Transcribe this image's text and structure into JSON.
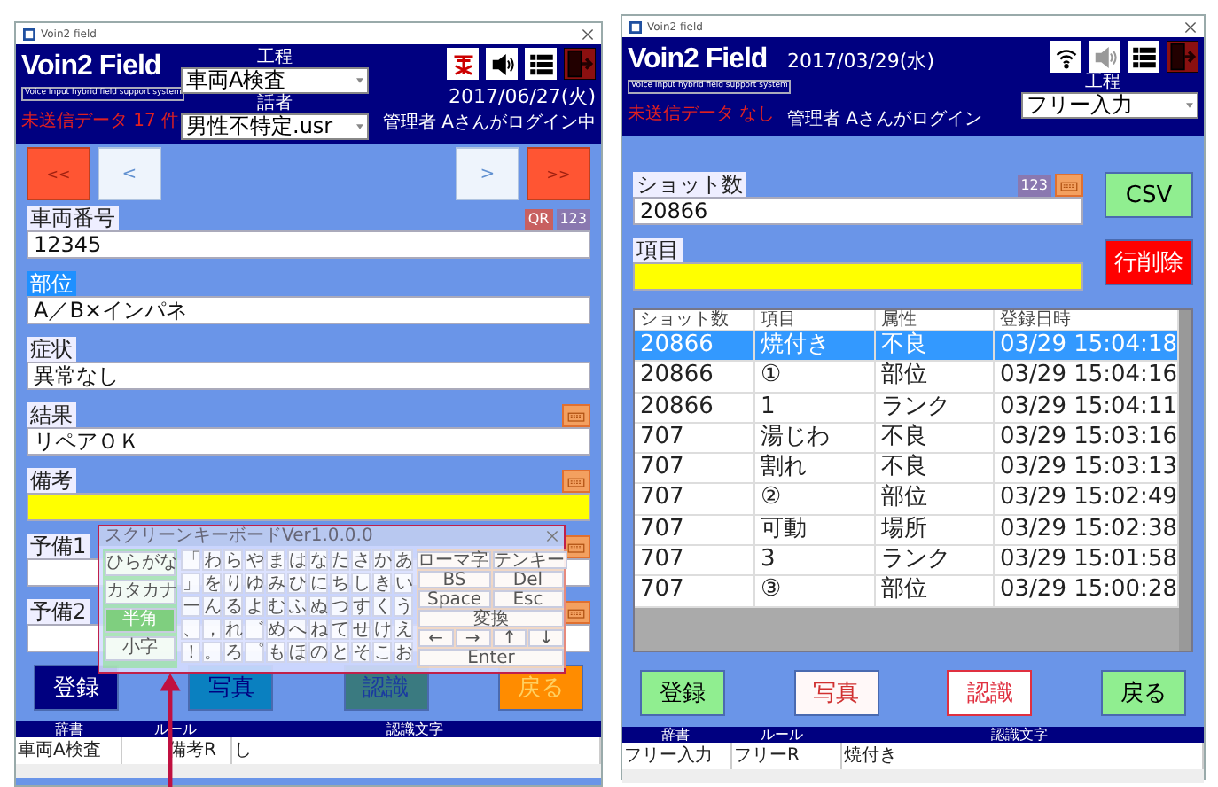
{
  "left_window": {
    "title": "Voin2 field",
    "logo": "Voin2 Field",
    "tagline": "Voice Input hybrid field support system",
    "unsent": "未送信データ 17 件",
    "process": {
      "label": "工程",
      "value": "車両A検査"
    },
    "speaker": {
      "label": "話者",
      "value": "男性不特定.usr"
    },
    "toolbar": [
      {
        "kind": "no-signal"
      },
      {
        "kind": "speaker",
        "disabled": false
      },
      {
        "kind": "list"
      },
      {
        "kind": "exit"
      }
    ],
    "date": "2017/06/27(火)",
    "login": "管理者 Aさんがログイン中",
    "nav_buttons": [
      {
        "label": "<<",
        "kind": "jump"
      },
      {
        "label": "<",
        "kind": "step"
      },
      {
        "label": ">",
        "kind": "step"
      },
      {
        "label": ">>",
        "kind": "jump"
      }
    ],
    "fields": [
      {
        "label": "車両番号",
        "value": "12345",
        "selected": false,
        "focused": false,
        "tools": [
          {
            "kind": "qr",
            "label": "QR"
          },
          {
            "kind": "numpad",
            "label": "123"
          }
        ]
      },
      {
        "label": "部位",
        "value": "A／B×インパネ",
        "selected": true,
        "focused": false
      },
      {
        "label": "症状",
        "value": "異常なし",
        "selected": false,
        "focused": false
      },
      {
        "label": "結果",
        "value": "リペアＯＫ",
        "selected": false,
        "focused": false,
        "tools": [
          {
            "kind": "keyboard"
          }
        ]
      },
      {
        "label": "備考",
        "selected": false,
        "focused": true,
        "tools": [
          {
            "kind": "keyboard"
          }
        ]
      },
      {
        "label": "予備1",
        "selected": false,
        "focused": false,
        "tools": [
          {
            "kind": "keyboard"
          }
        ]
      },
      {
        "label": "予備2",
        "selected": false,
        "focused": false,
        "tools": [
          {
            "kind": "keyboard"
          }
        ]
      }
    ],
    "keyboard": {
      "title": "スクリーンキーボードVer1.0.0.0",
      "modes": [
        {
          "label": "ひらがな",
          "selected": false
        },
        {
          "label": "カタカナ",
          "selected": false
        },
        {
          "label": "半角",
          "selected": true
        },
        {
          "label": "小字",
          "selected": false
        }
      ],
      "kana_rows": [
        [
          "「",
          "わ",
          "ら",
          "や",
          "ま",
          "は",
          "な",
          "た",
          "さ",
          "か",
          "あ"
        ],
        [
          "」",
          "を",
          "り",
          "ゆ",
          "み",
          "ひ",
          "に",
          "ち",
          "し",
          "き",
          "い"
        ],
        [
          "ー",
          "ん",
          "る",
          "よ",
          "む",
          "ふ",
          "ぬ",
          "つ",
          "す",
          "く",
          "う"
        ],
        [
          "、",
          "，",
          "れ",
          "゛",
          "め",
          "へ",
          "ね",
          "て",
          "せ",
          "け",
          "え"
        ],
        [
          "！",
          "。",
          "ろ",
          "゜",
          "も",
          "ほ",
          "の",
          "と",
          "そ",
          "こ",
          "お"
        ]
      ],
      "key_rows": [
        [
          "ローマ字",
          "テンキー"
        ],
        [
          "BS",
          "Del"
        ],
        [
          "Space",
          "Esc"
        ],
        [
          "変換"
        ],
        [
          "←",
          "→",
          "↑",
          "↓"
        ],
        [
          "Enter"
        ]
      ]
    },
    "buttons": [
      {
        "label": "登録",
        "color": "#000080",
        "kind": "inverse"
      },
      {
        "label": "写真",
        "color": "#0a80c0",
        "kind": "navy"
      },
      {
        "label": "認識",
        "color": "#3a7a80",
        "kind": "blue"
      },
      {
        "label": "戻る",
        "color": "#ff8c00",
        "kind": "gold"
      }
    ],
    "status": {
      "columns": [
        "辞書",
        "ルール",
        "認識文字"
      ],
      "values": [
        "車両A検査",
        "備考R",
        "し"
      ]
    }
  },
  "right_window": {
    "title": "Voin2 field",
    "logo": "Voin2 Field",
    "tagline": "Voice Input hybrid field support system",
    "unsent": "未送信データ なし",
    "date": "2017/03/29(水)",
    "login": "管理者 Aさんがログイン",
    "toolbar": [
      {
        "kind": "wifi"
      },
      {
        "kind": "speaker",
        "disabled": true
      },
      {
        "kind": "list"
      },
      {
        "kind": "exit"
      }
    ],
    "process": {
      "label": "工程",
      "value": "フリー入力"
    },
    "fields": [
      {
        "label": "ショット数",
        "value": "20866",
        "selected": false,
        "focused": false,
        "tools": [
          {
            "kind": "numpad",
            "label": "123"
          },
          {
            "kind": "keyboard"
          }
        ]
      },
      {
        "label": "項目",
        "selected": false,
        "focused": true
      }
    ],
    "side_buttons": [
      {
        "label": "CSV",
        "color": "#90ee90",
        "kind": "plain"
      },
      {
        "label": "行削除",
        "color": "#ff0000",
        "kind": "inverse"
      }
    ],
    "table": {
      "columns": [
        "ショット数",
        "項目",
        "属性",
        "登録日時"
      ],
      "rows": [
        {
          "cells": [
            "20866",
            "焼付き",
            "不良",
            "03/29 15:04:18"
          ],
          "selected": true
        },
        {
          "cells": [
            "20866",
            "①",
            "部位",
            "03/29 15:04:16"
          ],
          "selected": false
        },
        {
          "cells": [
            "20866",
            "1",
            "ランク",
            "03/29 15:04:11"
          ],
          "selected": false
        },
        {
          "cells": [
            "707",
            "湯じわ",
            "不良",
            "03/29 15:03:16"
          ],
          "selected": false
        },
        {
          "cells": [
            "707",
            "割れ",
            "不良",
            "03/29 15:03:13"
          ],
          "selected": false
        },
        {
          "cells": [
            "707",
            "②",
            "部位",
            "03/29 15:02:49"
          ],
          "selected": false
        },
        {
          "cells": [
            "707",
            "可動",
            "場所",
            "03/29 15:02:38"
          ],
          "selected": false
        },
        {
          "cells": [
            "707",
            "3",
            "ランク",
            "03/29 15:01:58"
          ],
          "selected": false
        },
        {
          "cells": [
            "707",
            "③",
            "部位",
            "03/29 15:00:28"
          ],
          "selected": false
        }
      ]
    },
    "buttons": [
      {
        "label": "登録",
        "color": "#90ee90",
        "kind": "plain"
      },
      {
        "label": "写真",
        "color": "#fff8f8",
        "kind": "alert"
      },
      {
        "label": "認識",
        "color": "#ffffff",
        "kind": "outline"
      },
      {
        "label": "戻る",
        "color": "#90ee90",
        "kind": "plain"
      }
    ],
    "status": {
      "columns": [
        "辞書",
        "ルール",
        "認識文字"
      ],
      "values": [
        "フリー入力",
        "フリーR",
        "焼付き"
      ]
    }
  }
}
